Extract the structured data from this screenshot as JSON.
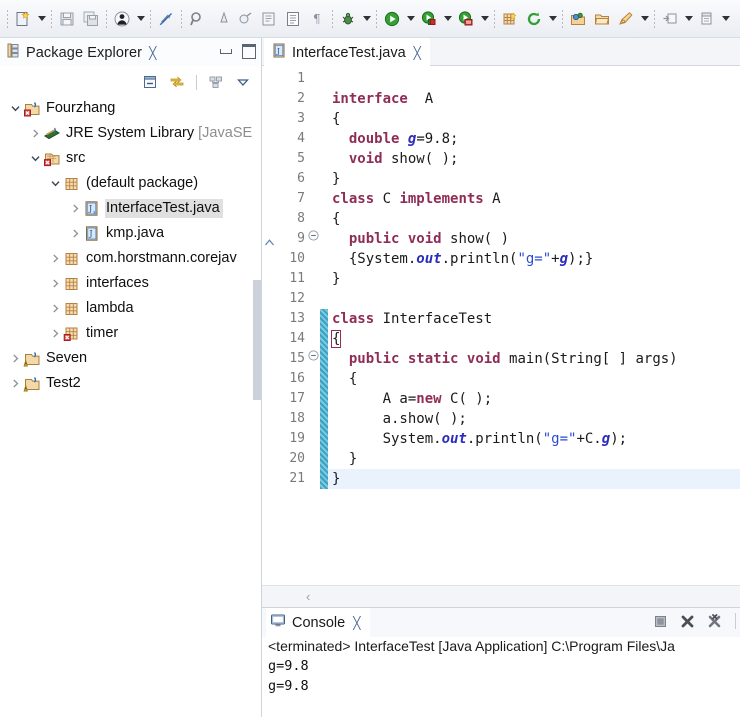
{
  "toolbar": {
    "groups": [
      {
        "name": "new-group",
        "buttons": [
          {
            "icon": "new-wizard-icon",
            "label": "New",
            "dropdown": true
          }
        ]
      },
      {
        "name": "save-group",
        "buttons": [
          {
            "icon": "save-icon",
            "label": "Save",
            "dropdown": false
          },
          {
            "icon": "save-all-icon",
            "label": "Save All",
            "dropdown": false
          }
        ]
      },
      {
        "name": "print-group",
        "buttons": [
          {
            "icon": "person-icon",
            "label": "Toggle Person",
            "dropdown": true
          }
        ]
      },
      {
        "name": "link-group",
        "buttons": [
          {
            "icon": "no-link-icon",
            "label": "Skip All Breakpoints",
            "dropdown": false
          }
        ]
      },
      {
        "name": "search-group",
        "buttons": [
          {
            "icon": "search-icon",
            "label": "Search",
            "dropdown": false
          },
          {
            "icon": "ruler-icon",
            "label": "Ruler",
            "dropdown": false
          },
          {
            "icon": "coverage-icon",
            "label": "Coverage",
            "dropdown": false
          },
          {
            "icon": "next-annotation-icon",
            "label": "Next Annotation",
            "dropdown": false
          },
          {
            "icon": "toggle-block-icon",
            "label": "Toggle Block Selection",
            "dropdown": false
          },
          {
            "icon": "pilcrow-icon",
            "label": "Show Whitespace",
            "dropdown": false
          }
        ]
      },
      {
        "name": "debug-group",
        "buttons": [
          {
            "icon": "debug-bug-icon",
            "label": "Debug",
            "dropdown": true
          }
        ]
      },
      {
        "name": "run-group",
        "buttons": [
          {
            "icon": "run-play-icon",
            "label": "Run",
            "dropdown": true
          },
          {
            "icon": "run-coverage-icon",
            "label": "Coverage As",
            "dropdown": true
          },
          {
            "icon": "run-server-icon",
            "label": "Run on Server",
            "dropdown": true
          }
        ]
      },
      {
        "name": "package-group",
        "buttons": [
          {
            "icon": "new-package-icon",
            "label": "New Java Package",
            "dropdown": false
          },
          {
            "icon": "refresh-arrow-icon",
            "label": "External Tools",
            "dropdown": true
          }
        ]
      },
      {
        "name": "class-group",
        "buttons": [
          {
            "icon": "new-class-icon",
            "label": "New Java Class",
            "dropdown": false
          },
          {
            "icon": "open-folder-icon",
            "label": "Open Type",
            "dropdown": false
          },
          {
            "icon": "pen-tool-icon",
            "label": "New Annotation",
            "dropdown": true
          }
        ]
      },
      {
        "name": "view-group",
        "buttons": [
          {
            "icon": "open-declaration-icon",
            "label": "Open Declaration",
            "dropdown": true
          },
          {
            "icon": "open-resource-icon",
            "label": "Open Resource",
            "dropdown": true
          }
        ]
      }
    ]
  },
  "explorer": {
    "title": "Package Explorer",
    "close_glyph": "╳",
    "toolbar": [
      {
        "icon": "collapse-all-icon",
        "label": "Collapse All"
      },
      {
        "icon": "link-with-editor-icon",
        "label": "Link with Editor"
      },
      {
        "icon": "focus-on-active-task-icon",
        "label": "Focus on Active Task"
      },
      {
        "icon": "view-menu-icon",
        "label": "View Menu"
      }
    ],
    "window_buttons": [
      {
        "icon": "minimize-icon",
        "label": "Minimize"
      },
      {
        "icon": "maximize-icon",
        "label": "Maximize"
      }
    ],
    "tree": [
      {
        "depth": 0,
        "twisty": "down",
        "icon": "java-project-error-icon",
        "label": "Fourzhang",
        "dim": "",
        "selected": false
      },
      {
        "depth": 1,
        "twisty": "right",
        "icon": "jre-library-icon",
        "label": "JRE System Library ",
        "dim": "[JavaSE",
        "selected": false
      },
      {
        "depth": 1,
        "twisty": "down",
        "icon": "source-folder-error-icon",
        "label": "src",
        "dim": "",
        "selected": false
      },
      {
        "depth": 2,
        "twisty": "down",
        "icon": "package-icon",
        "label": "(default package)",
        "dim": "",
        "selected": false
      },
      {
        "depth": 3,
        "twisty": "right",
        "icon": "java-file-main-icon",
        "label": "InterfaceTest.java",
        "dim": "",
        "selected": true
      },
      {
        "depth": 3,
        "twisty": "right",
        "icon": "java-file-icon",
        "label": "kmp.java",
        "dim": "",
        "selected": false
      },
      {
        "depth": 2,
        "twisty": "right",
        "icon": "package-icon",
        "label": "com.horstmann.corejav",
        "dim": "",
        "selected": false
      },
      {
        "depth": 2,
        "twisty": "right",
        "icon": "package-icon",
        "label": "interfaces",
        "dim": "",
        "selected": false
      },
      {
        "depth": 2,
        "twisty": "right",
        "icon": "package-icon",
        "label": "lambda",
        "dim": "",
        "selected": false
      },
      {
        "depth": 2,
        "twisty": "right",
        "icon": "package-error-icon",
        "label": "timer",
        "dim": "",
        "selected": false
      },
      {
        "depth": 0,
        "twisty": "right",
        "icon": "java-project-warn-icon",
        "label": "Seven",
        "dim": "",
        "selected": false
      },
      {
        "depth": 0,
        "twisty": "right",
        "icon": "java-project-warn-icon",
        "label": "Test2",
        "dim": "",
        "selected": false
      }
    ]
  },
  "editor": {
    "tab": {
      "icon": "java-file-icon",
      "label": "InterfaceTest.java",
      "close_glyph": "╳"
    },
    "lines": [
      {
        "n": "1",
        "fold": false,
        "changed": false,
        "hl": false,
        "tokens": []
      },
      {
        "n": "2",
        "fold": false,
        "changed": false,
        "hl": false,
        "tokens": [
          {
            "t": "kw",
            "v": "interface"
          },
          {
            "t": "plain",
            "v": "  A"
          }
        ]
      },
      {
        "n": "3",
        "fold": false,
        "changed": false,
        "hl": false,
        "tokens": [
          {
            "t": "plain",
            "v": "{"
          }
        ]
      },
      {
        "n": "4",
        "fold": false,
        "changed": false,
        "hl": false,
        "tokens": [
          {
            "t": "plain",
            "v": "  "
          },
          {
            "t": "kw",
            "v": "double"
          },
          {
            "t": "plain",
            "v": " "
          },
          {
            "t": "fld",
            "v": "g"
          },
          {
            "t": "plain",
            "v": "=9.8;"
          }
        ]
      },
      {
        "n": "5",
        "fold": false,
        "changed": false,
        "hl": false,
        "tokens": [
          {
            "t": "plain",
            "v": "  "
          },
          {
            "t": "kw",
            "v": "void"
          },
          {
            "t": "plain",
            "v": " show( );"
          }
        ]
      },
      {
        "n": "6",
        "fold": false,
        "changed": false,
        "hl": false,
        "tokens": [
          {
            "t": "plain",
            "v": "}"
          }
        ]
      },
      {
        "n": "7",
        "fold": false,
        "changed": false,
        "hl": false,
        "tokens": [
          {
            "t": "kw",
            "v": "class"
          },
          {
            "t": "plain",
            "v": " C "
          },
          {
            "t": "kw",
            "v": "implements"
          },
          {
            "t": "plain",
            "v": " A"
          }
        ]
      },
      {
        "n": "8",
        "fold": false,
        "changed": false,
        "hl": false,
        "tokens": [
          {
            "t": "plain",
            "v": "{"
          }
        ]
      },
      {
        "n": "9",
        "fold": true,
        "changed": false,
        "hl": false,
        "tokens": [
          {
            "t": "plain",
            "v": "  "
          },
          {
            "t": "kw",
            "v": "public"
          },
          {
            "t": "plain",
            "v": " "
          },
          {
            "t": "kw",
            "v": "void"
          },
          {
            "t": "plain",
            "v": " show( )"
          }
        ]
      },
      {
        "n": "10",
        "fold": false,
        "changed": false,
        "hl": false,
        "tokens": [
          {
            "t": "plain",
            "v": "  {System."
          },
          {
            "t": "stat",
            "v": "out"
          },
          {
            "t": "plain",
            "v": ".println("
          },
          {
            "t": "str",
            "v": "\"g=\""
          },
          {
            "t": "plain",
            "v": "+"
          },
          {
            "t": "fld",
            "v": "g"
          },
          {
            "t": "plain",
            "v": ");}"
          }
        ]
      },
      {
        "n": "11",
        "fold": false,
        "changed": false,
        "hl": false,
        "tokens": [
          {
            "t": "plain",
            "v": "}"
          }
        ]
      },
      {
        "n": "12",
        "fold": false,
        "changed": false,
        "hl": false,
        "tokens": []
      },
      {
        "n": "13",
        "fold": false,
        "changed": true,
        "hl": false,
        "tokens": [
          {
            "t": "kw",
            "v": "class"
          },
          {
            "t": "plain",
            "v": " InterfaceTest"
          }
        ]
      },
      {
        "n": "14",
        "fold": false,
        "changed": true,
        "hl": false,
        "tokens": [
          {
            "t": "brkt",
            "v": "{"
          }
        ]
      },
      {
        "n": "15",
        "fold": true,
        "changed": true,
        "hl": false,
        "tokens": [
          {
            "t": "plain",
            "v": "  "
          },
          {
            "t": "kw",
            "v": "public"
          },
          {
            "t": "plain",
            "v": " "
          },
          {
            "t": "kw",
            "v": "static"
          },
          {
            "t": "plain",
            "v": " "
          },
          {
            "t": "kw",
            "v": "void"
          },
          {
            "t": "plain",
            "v": " main(String[ ] args)"
          }
        ]
      },
      {
        "n": "16",
        "fold": false,
        "changed": true,
        "hl": false,
        "tokens": [
          {
            "t": "plain",
            "v": "  {"
          }
        ]
      },
      {
        "n": "17",
        "fold": false,
        "changed": true,
        "hl": false,
        "tokens": [
          {
            "t": "plain",
            "v": "      A a="
          },
          {
            "t": "kw",
            "v": "new"
          },
          {
            "t": "plain",
            "v": " C( );"
          }
        ]
      },
      {
        "n": "18",
        "fold": false,
        "changed": true,
        "hl": false,
        "tokens": [
          {
            "t": "plain",
            "v": "      a.show( );"
          }
        ]
      },
      {
        "n": "19",
        "fold": false,
        "changed": true,
        "hl": false,
        "tokens": [
          {
            "t": "plain",
            "v": "      System."
          },
          {
            "t": "stat",
            "v": "out"
          },
          {
            "t": "plain",
            "v": ".println("
          },
          {
            "t": "str",
            "v": "\"g=\""
          },
          {
            "t": "plain",
            "v": "+C."
          },
          {
            "t": "fld",
            "v": "g"
          },
          {
            "t": "plain",
            "v": ");"
          }
        ]
      },
      {
        "n": "20",
        "fold": false,
        "changed": true,
        "hl": false,
        "tokens": [
          {
            "t": "plain",
            "v": "  }"
          }
        ]
      },
      {
        "n": "21",
        "fold": false,
        "changed": true,
        "hl": true,
        "tokens": [
          {
            "t": "plain",
            "v": "}"
          }
        ]
      }
    ],
    "hscroll_arrow": "‹"
  },
  "console": {
    "title": "Console",
    "close_glyph": "╳",
    "tools": [
      {
        "icon": "terminate-icon",
        "label": "Terminate"
      },
      {
        "icon": "remove-launch-icon",
        "label": "Remove Launch"
      },
      {
        "icon": "remove-all-terminated-icon",
        "label": "Remove All Terminated Launches"
      }
    ],
    "header": "<terminated> InterfaceTest [Java Application] C:\\Program Files\\Ja",
    "output": [
      "g=9.8",
      "g=9.8"
    ]
  },
  "colors": {
    "keyword": "#8f2d56",
    "field": "#2b2bbd",
    "string": "#2a4ad6",
    "selection": "#e0e0e0",
    "current_line": "#eaf2fd",
    "change_bar": "#36a3c4",
    "toolbar_bg": "#f1f3f7"
  }
}
